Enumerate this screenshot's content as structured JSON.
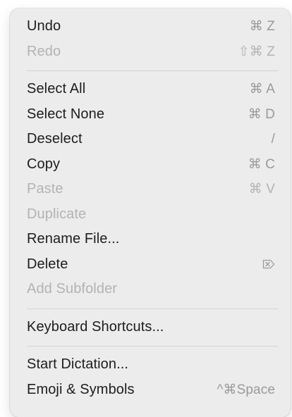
{
  "menu": {
    "items": [
      {
        "label": "Undo",
        "shortcut": "⌘ Z",
        "enabled": true
      },
      {
        "label": "Redo",
        "shortcut": "⇧⌘ Z",
        "enabled": false
      },
      {
        "label": "Select All",
        "shortcut": "⌘ A",
        "enabled": true
      },
      {
        "label": "Select None",
        "shortcut": "⌘ D",
        "enabled": true
      },
      {
        "label": "Deselect",
        "shortcut": "/",
        "enabled": true
      },
      {
        "label": "Copy",
        "shortcut": "⌘ C",
        "enabled": true
      },
      {
        "label": "Paste",
        "shortcut": "⌘ V",
        "enabled": false
      },
      {
        "label": "Duplicate",
        "shortcut": "",
        "enabled": false
      },
      {
        "label": "Rename File...",
        "shortcut": "",
        "enabled": true
      },
      {
        "label": "Delete",
        "shortcut_icon": "delete-forward-icon",
        "enabled": true
      },
      {
        "label": "Add Subfolder",
        "shortcut": "",
        "enabled": false
      },
      {
        "label": "Keyboard Shortcuts...",
        "shortcut": "",
        "enabled": true
      },
      {
        "label": "Start Dictation...",
        "shortcut": "",
        "enabled": true
      },
      {
        "label": "Emoji & Symbols",
        "shortcut": "^⌘Space",
        "enabled": true
      }
    ]
  },
  "colors": {
    "menu_background": "#ececec",
    "text_enabled": "#1d1d1f",
    "text_disabled": "#b3b3b3",
    "shortcut": "#9a9a9a",
    "separator": "#d3d3d3"
  }
}
